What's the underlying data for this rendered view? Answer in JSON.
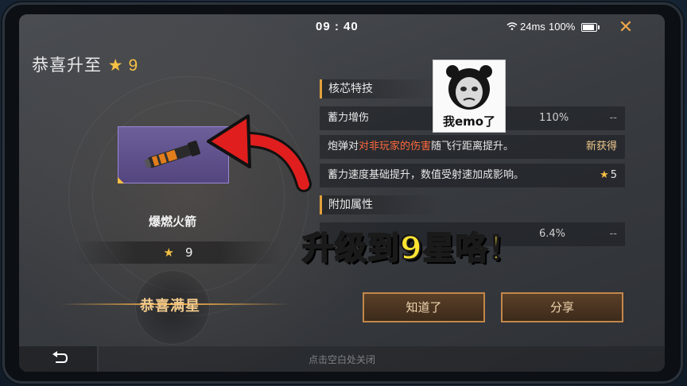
{
  "status_bar": {
    "time": "09 : 40",
    "ping": "24ms",
    "battery": "100%",
    "battery_level": 1.0
  },
  "header": {
    "title": "恭喜升至",
    "star_level": "9"
  },
  "item": {
    "name": "爆燃火箭",
    "stars": "9",
    "full_star_label": "恭喜满星"
  },
  "sections": {
    "core": {
      "title": "核芯特技",
      "rows": [
        {
          "name": "蓄力增伤",
          "value": "110%",
          "change": "--"
        },
        {
          "name_prefix": "炮弹对",
          "name_highlight": "对非玩家的伤害",
          "name_suffix": "随飞行距离提升。",
          "change": "新获得"
        },
        {
          "name": "蓄力速度基础提升，数值受射速加成影响。",
          "change": "5"
        }
      ]
    },
    "extra": {
      "title": "附加属性",
      "rows": [
        {
          "name": "",
          "value": "6.4%",
          "change": "--"
        }
      ]
    }
  },
  "buttons": {
    "ok": "知道了",
    "share": "分享"
  },
  "footer": {
    "hint": "点击空白处关闭"
  },
  "overlay": {
    "meme_caption": "我emo了",
    "caption": "升级到9星咯！"
  },
  "colors": {
    "accent": "#f5c044",
    "button_border": "#c3874a",
    "overlay_text": "#ffe432",
    "arrow": "#e01e1e",
    "card": "#5e4f8c"
  },
  "icons": {
    "wifi": "wifi-icon",
    "battery": "battery-icon",
    "close": "close-icon",
    "star": "star-icon",
    "back": "back-arrow-icon"
  }
}
